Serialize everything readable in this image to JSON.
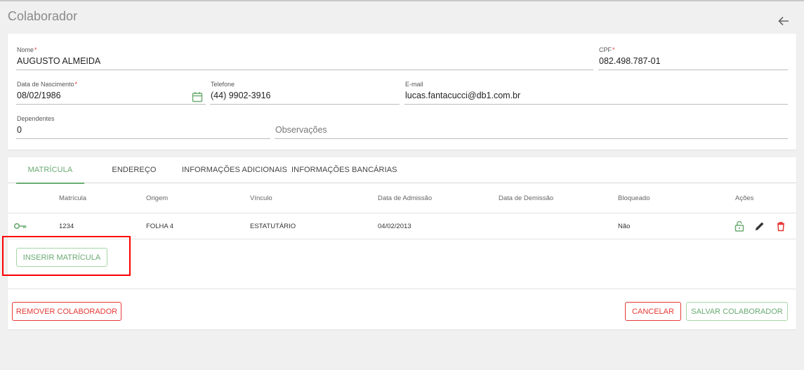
{
  "page": {
    "title": "Colaborador"
  },
  "form": {
    "nome": {
      "label": "Nome",
      "value": "AUGUSTO ALMEIDA",
      "required": "*"
    },
    "cpf": {
      "label": "CPF",
      "value": "082.498.787-01",
      "required": "*"
    },
    "data_nascimento": {
      "label": "Data de Nascimento",
      "value": "08/02/1986",
      "required": "*"
    },
    "telefone": {
      "label": "Telefone",
      "value": "(44) 9902-3916"
    },
    "email": {
      "label": "E-mail",
      "value": "lucas.fantacucci@db1.com.br"
    },
    "dependentes": {
      "label": "Dependentes",
      "value": "0"
    },
    "observacoes": {
      "placeholder": "Observações",
      "value": ""
    }
  },
  "tabs": [
    {
      "label": "MATRÍCULA",
      "active": true
    },
    {
      "label": "ENDEREÇO"
    },
    {
      "label": "INFORMAÇÕES ADICIONAIS"
    },
    {
      "label": "INFORMAÇÕES BANCÁRIAS"
    }
  ],
  "table": {
    "headers": [
      "Matrícula",
      "Origem",
      "Vínculo",
      "Data de Admissão",
      "Data de Demissão",
      "Bloqueado",
      "Ações"
    ],
    "rows": [
      {
        "icon": "key-icon",
        "matricula": "1234",
        "origem": "FOLHA 4",
        "vinculo": "ESTATUTÁRIO",
        "data_admissao": "04/02/2013",
        "data_demissao": "",
        "bloqueado": "Não"
      }
    ]
  },
  "buttons": {
    "inserir_matricula": "INSERIR MATRÍCULA",
    "remover_colaborador": "REMOVER COLABORADOR",
    "cancelar": "CANCELAR",
    "salvar_colaborador": "SALVAR COLABORADOR"
  },
  "icons": {
    "back": "arrow-left-icon",
    "calendar": "calendar-icon",
    "row": "key-icon",
    "actions": [
      "lock-open-icon",
      "pencil-icon",
      "trash-icon"
    ]
  },
  "colors": {
    "accent": "#6aab72",
    "danger": "#e53935",
    "highlight": "#ff0000"
  }
}
